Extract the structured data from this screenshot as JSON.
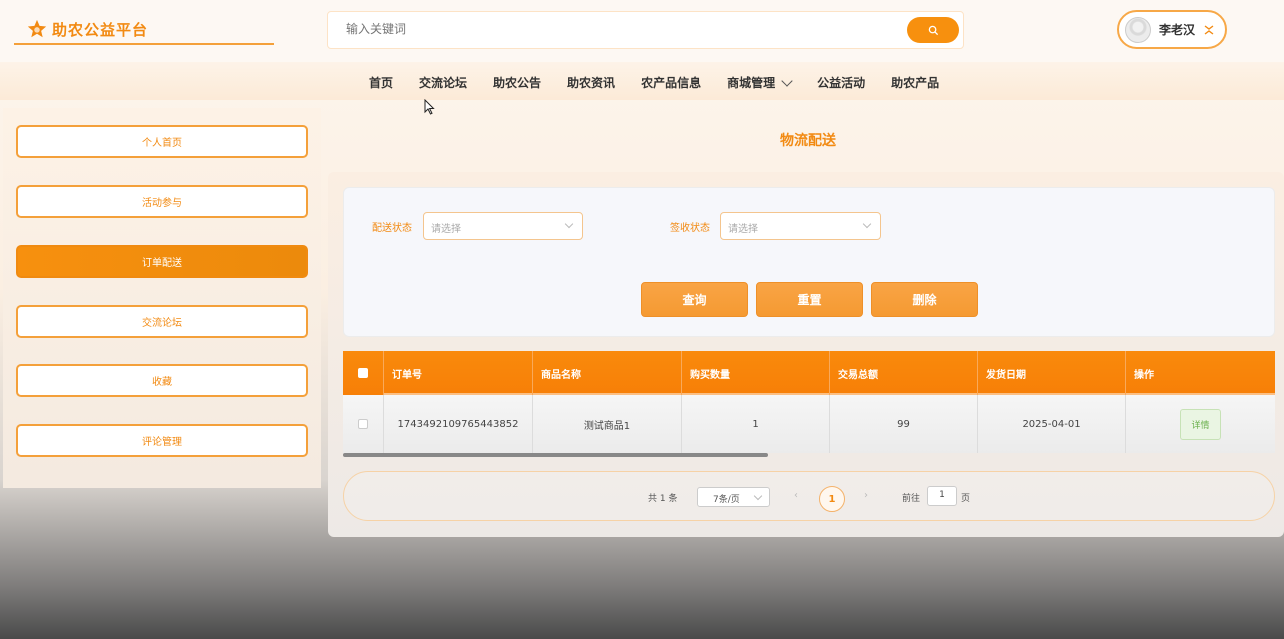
{
  "header": {
    "logo_text": "助农公益平台",
    "search_placeholder": "输入关键词",
    "user_name": "李老汉"
  },
  "nav": {
    "items": [
      "首页",
      "交流论坛",
      "助农公告",
      "助农资讯",
      "农产品信息",
      "商城管理",
      "公益活动",
      "助农产品"
    ]
  },
  "sidebar": {
    "items": [
      "个人首页",
      "活动参与",
      "订单配送",
      "交流论坛",
      "收藏",
      "评论管理"
    ],
    "active_index": 2
  },
  "main": {
    "title": "物流配送",
    "filters": {
      "delivery_status_label": "配送状态",
      "delivery_status_placeholder": "请选择",
      "sign_status_label": "签收状态",
      "sign_status_placeholder": "请选择"
    },
    "buttons": {
      "query": "查询",
      "reset": "重置",
      "delete": "删除"
    },
    "table": {
      "columns": [
        "订单号",
        "商品名称",
        "购买数量",
        "交易总额",
        "发货日期",
        "操作"
      ],
      "rows": [
        {
          "order_no": "1743492109765443852",
          "product": "测试商品1",
          "qty": "1",
          "total": "99",
          "ship_date": "2025-04-01",
          "action": "详情"
        }
      ]
    },
    "pagination": {
      "total_text": "共 1 条",
      "page_size": "7条/页",
      "prev": "‹",
      "current_page": "1",
      "next": "›",
      "goto_label": "前往",
      "goto_value": "1",
      "page_suffix": "页"
    }
  },
  "colors": {
    "accent": "#f28a12",
    "accent_dark": "#ec8a0c"
  }
}
